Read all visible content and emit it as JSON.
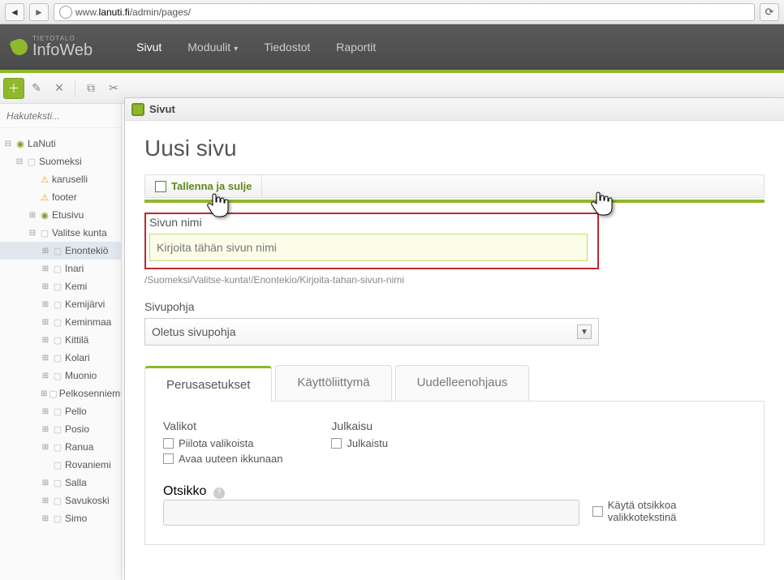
{
  "browser": {
    "url_pre": "www.",
    "url_domain": "lanuti.fi",
    "url_post": "/admin/pages/"
  },
  "brand": {
    "top": "TIETOTALO",
    "name": "InfoWeb"
  },
  "topnav": {
    "items": [
      {
        "label": "Sivut",
        "active": true,
        "chev": false
      },
      {
        "label": "Moduulit",
        "active": false,
        "chev": true
      },
      {
        "label": "Tiedostot",
        "active": false,
        "chev": false
      },
      {
        "label": "Raportit",
        "active": false,
        "chev": false
      }
    ]
  },
  "search": {
    "placeholder": "Hakuteksti..."
  },
  "tree": [
    {
      "indent": 0,
      "exp": "⊟",
      "icon": "folder",
      "label": "LaNuti"
    },
    {
      "indent": 1,
      "exp": "⊟",
      "icon": "page",
      "label": "Suomeksi"
    },
    {
      "indent": 2,
      "exp": "",
      "icon": "warn",
      "label": "karuselli"
    },
    {
      "indent": 2,
      "exp": "",
      "icon": "warn",
      "label": "footer"
    },
    {
      "indent": 2,
      "exp": "⊞",
      "icon": "folder",
      "label": "Etusivu"
    },
    {
      "indent": 2,
      "exp": "⊟",
      "icon": "page",
      "label": "Valitse kunta"
    },
    {
      "indent": 3,
      "exp": "⊞",
      "icon": "page",
      "label": "Enontekiö",
      "selected": true
    },
    {
      "indent": 3,
      "exp": "⊞",
      "icon": "page",
      "label": "Inari"
    },
    {
      "indent": 3,
      "exp": "⊞",
      "icon": "page",
      "label": "Kemi"
    },
    {
      "indent": 3,
      "exp": "⊞",
      "icon": "page",
      "label": "Kemijärvi"
    },
    {
      "indent": 3,
      "exp": "⊞",
      "icon": "page",
      "label": "Keminmaa"
    },
    {
      "indent": 3,
      "exp": "⊞",
      "icon": "page",
      "label": "Kittilä"
    },
    {
      "indent": 3,
      "exp": "⊞",
      "icon": "page",
      "label": "Kolari"
    },
    {
      "indent": 3,
      "exp": "⊞",
      "icon": "page",
      "label": "Muonio"
    },
    {
      "indent": 3,
      "exp": "⊞",
      "icon": "page",
      "label": "Pelkosenniemi"
    },
    {
      "indent": 3,
      "exp": "⊞",
      "icon": "page",
      "label": "Pello"
    },
    {
      "indent": 3,
      "exp": "⊞",
      "icon": "page",
      "label": "Posio"
    },
    {
      "indent": 3,
      "exp": "⊞",
      "icon": "page",
      "label": "Ranua"
    },
    {
      "indent": 3,
      "exp": "",
      "icon": "page",
      "label": "Rovaniemi"
    },
    {
      "indent": 3,
      "exp": "⊞",
      "icon": "page",
      "label": "Salla"
    },
    {
      "indent": 3,
      "exp": "⊞",
      "icon": "page",
      "label": "Savukoski"
    },
    {
      "indent": 3,
      "exp": "⊞",
      "icon": "page",
      "label": "Simo"
    }
  ],
  "modal": {
    "title": "Sivut",
    "page_title": "Uusi sivu",
    "save_label": "Tallenna ja sulje",
    "name_label": "Sivun nimi",
    "name_placeholder": "Kirjoita tähän sivun nimi",
    "path": "/Suomeksi/Valitse-kunta!/Enontekio/Kirjoita-tahan-sivun-nimi",
    "template_label": "Sivupohja",
    "template_value": "Oletus sivupohja",
    "tabs": [
      {
        "label": "Perusasetukset",
        "active": true
      },
      {
        "label": "Käyttöliittymä",
        "active": false
      },
      {
        "label": "Uudelleenohjaus",
        "active": false
      }
    ],
    "menus_label": "Valikot",
    "publish_label": "Julkaisu",
    "chk_hide": "Piilota valikoista",
    "chk_newwin": "Avaa uuteen ikkunaan",
    "chk_published": "Julkaistu",
    "title_label": "Otsikko",
    "chk_use_title": "Käytä otsikkoa valikkotekstinä"
  }
}
